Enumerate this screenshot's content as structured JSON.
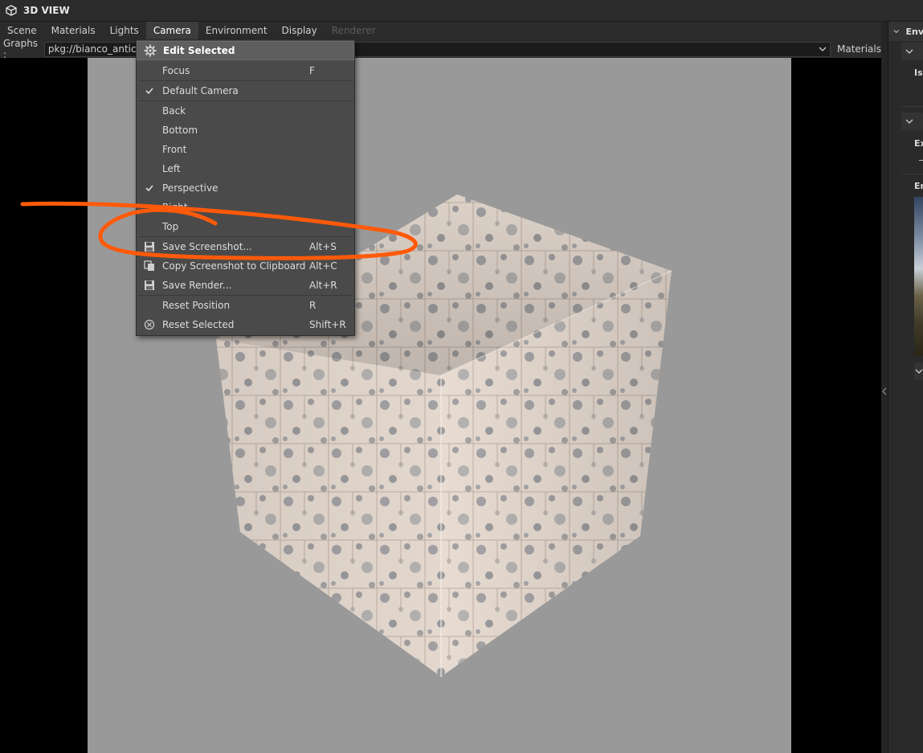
{
  "window": {
    "title": "3D VIEW",
    "icon": "cube-icon"
  },
  "menubar": {
    "items": [
      {
        "label": "Scene",
        "state": "normal"
      },
      {
        "label": "Materials",
        "state": "normal"
      },
      {
        "label": "Lights",
        "state": "normal"
      },
      {
        "label": "Camera",
        "state": "active"
      },
      {
        "label": "Environment",
        "state": "normal"
      },
      {
        "label": "Display",
        "state": "normal"
      },
      {
        "label": "Renderer",
        "state": "disabled"
      }
    ]
  },
  "graphs": {
    "label": "Graphs :",
    "value": "pkg://bianco_antico_",
    "materials_label": "Materials"
  },
  "camera_menu": {
    "header": {
      "label": "Edit Selected",
      "icon": "gear-icon"
    },
    "items": [
      {
        "label": "Focus",
        "shortcut": "F",
        "icon": ""
      },
      {
        "label": "Default Camera",
        "shortcut": "",
        "icon": "check-icon"
      },
      {
        "label": "Back",
        "shortcut": "",
        "icon": ""
      },
      {
        "label": "Bottom",
        "shortcut": "",
        "icon": ""
      },
      {
        "label": "Front",
        "shortcut": "",
        "icon": ""
      },
      {
        "label": "Left",
        "shortcut": "",
        "icon": ""
      },
      {
        "label": "Perspective",
        "shortcut": "",
        "icon": "check-icon"
      },
      {
        "label": "Right",
        "shortcut": "",
        "icon": ""
      },
      {
        "label": "Top",
        "shortcut": "",
        "icon": ""
      },
      {
        "label": "Save Screenshot...",
        "shortcut": "Alt+S",
        "icon": "floppy-disk-icon"
      },
      {
        "label": "Copy Screenshot to Clipboard",
        "shortcut": "Alt+C",
        "icon": "copy-icon"
      },
      {
        "label": "Save Render...",
        "shortcut": "Alt+R",
        "icon": "floppy-disk-icon"
      },
      {
        "label": "Reset Position",
        "shortcut": "R",
        "icon": ""
      },
      {
        "label": "Reset Selected",
        "shortcut": "Shift+R",
        "icon": "reset-icon"
      }
    ]
  },
  "right_panel": {
    "header": "Env",
    "texts": [
      "Is",
      "Ex",
      "En"
    ]
  },
  "colors": {
    "viewport_bg": "#999999",
    "menu_bg": "#4a4a4a",
    "annotation_stroke": "#ff5a0a"
  }
}
